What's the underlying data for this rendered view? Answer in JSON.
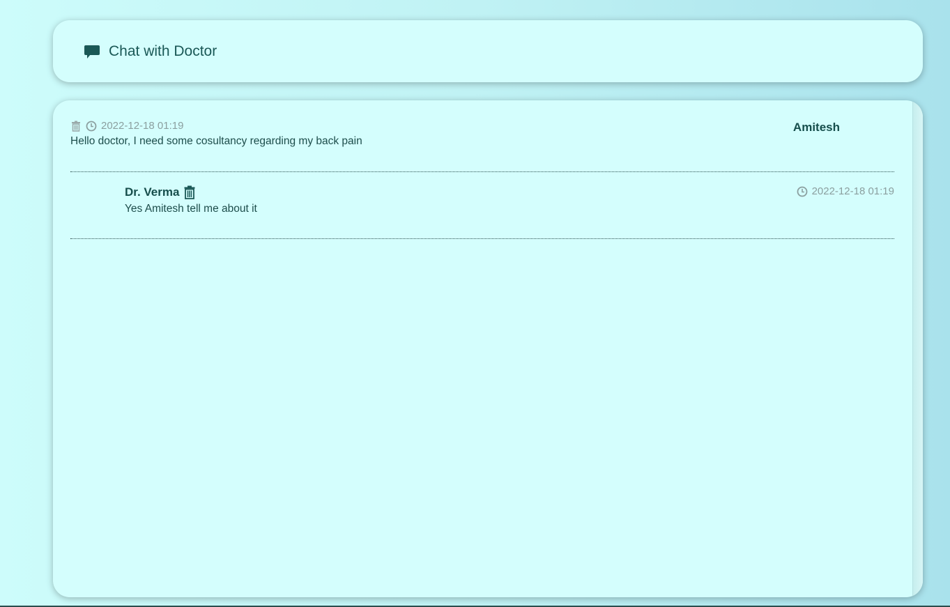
{
  "header": {
    "title": "Chat with Doctor",
    "icon": "chat-bubble-icon"
  },
  "messages": [
    {
      "sender": "Amitesh",
      "timestamp": "2022-12-18 01:19",
      "text": "Hello doctor, I need some cosultancy regarding my back pain",
      "align": "patient"
    },
    {
      "sender": "Dr. Verma",
      "timestamp": "2022-12-18 01:19",
      "text": "Yes Amitesh tell me about it",
      "align": "doctor"
    }
  ],
  "colors": {
    "accent": "#1a5856",
    "card_bg": "#d4fefd",
    "muted": "#8b9f9f"
  }
}
